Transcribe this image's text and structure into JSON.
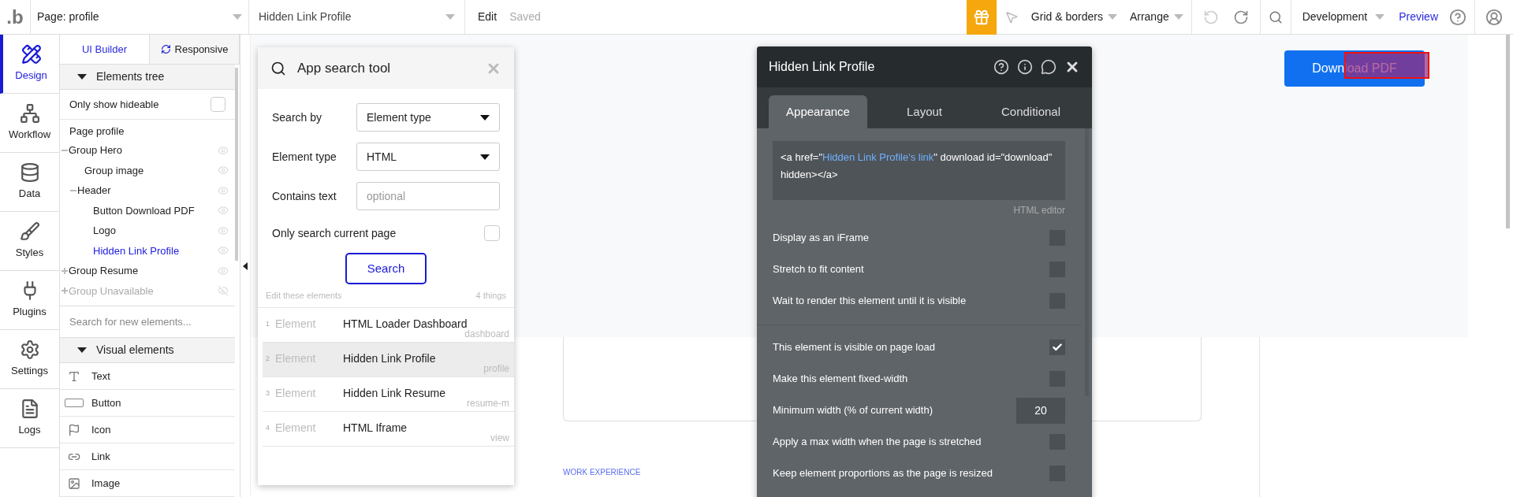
{
  "top_bar": {
    "logo": ".b",
    "page_dropdown": "Page: profile",
    "element_dropdown": "Hidden Link Profile",
    "edit_label": "Edit",
    "status": "Saved",
    "menus": [
      "Grid & borders",
      "Arrange"
    ],
    "environment": "Development",
    "preview": "Preview"
  },
  "left_nav": [
    {
      "label": "Design",
      "selected": true
    },
    {
      "label": "Workflow",
      "selected": false
    },
    {
      "label": "Data",
      "selected": false
    },
    {
      "label": "Styles",
      "selected": false
    },
    {
      "label": "Plugins",
      "selected": false
    },
    {
      "label": "Settings",
      "selected": false
    },
    {
      "label": "Logs",
      "selected": false
    }
  ],
  "panel_tabs": [
    {
      "label": "UI Builder",
      "selected": true
    },
    {
      "label": "Responsive",
      "selected": false
    }
  ],
  "elements_tree": {
    "title": "Elements tree",
    "filter": {
      "label": "Only show hideable",
      "checked": false
    },
    "page": "Page profile",
    "items": [
      {
        "label": "Group Hero",
        "kind": "group",
        "expanded": true,
        "selected": false,
        "hidden": false,
        "children": [
          {
            "label": "Group image",
            "kind": "element",
            "selected": false,
            "hidden": false
          },
          {
            "label": "Header",
            "kind": "group",
            "expanded": true,
            "selected": false,
            "hidden": false,
            "children": [
              {
                "label": "Button Download PDF",
                "kind": "element",
                "selected": false,
                "hidden": false
              },
              {
                "label": "Logo",
                "kind": "element",
                "selected": false,
                "hidden": false
              },
              {
                "label": "Hidden Link Profile",
                "kind": "element",
                "selected": true,
                "hidden": false
              }
            ]
          }
        ]
      },
      {
        "label": "Group Resume",
        "kind": "group",
        "expanded": false,
        "selected": false,
        "hidden": false
      },
      {
        "label": "Group Unavailable",
        "kind": "group",
        "expanded": false,
        "selected": false,
        "hidden": true
      }
    ]
  },
  "element_search": {
    "placeholder": "Search for new elements..."
  },
  "visual_elements": {
    "title": "Visual elements",
    "items": [
      "Text",
      "Button",
      "Icon",
      "Link",
      "Image"
    ]
  },
  "search_tool": {
    "title": "App search tool",
    "fields": [
      {
        "label": "Search by",
        "kind": "select",
        "value": "Element type"
      },
      {
        "label": "Element type",
        "kind": "select",
        "value": "HTML"
      },
      {
        "label": "Contains text",
        "kind": "text",
        "placeholder": "optional"
      }
    ],
    "option": {
      "label": "Only search current page",
      "checked": false
    },
    "button": "Search",
    "caption": "Edit these elements",
    "count": "4 things",
    "results": [
      {
        "index": "1",
        "type": "Element",
        "name": "HTML Loader Dashboard",
        "page": "dashboard",
        "selected": false
      },
      {
        "index": "2",
        "type": "Element",
        "name": "Hidden Link Profile",
        "page": "profile",
        "selected": true
      },
      {
        "index": "3",
        "type": "Element",
        "name": "Hidden Link Resume",
        "page": "resume-m",
        "selected": false
      },
      {
        "index": "4",
        "type": "Element",
        "name": "HTML Iframe",
        "page": "view",
        "selected": false
      }
    ]
  },
  "property_editor": {
    "title": "Hidden Link Profile",
    "tabs": [
      {
        "label": "Appearance",
        "selected": true
      },
      {
        "label": "Layout",
        "selected": false
      },
      {
        "label": "Conditional",
        "selected": false
      }
    ],
    "code": [
      {
        "kind": "plain",
        "text": "<a href=\""
      },
      {
        "kind": "dynamic",
        "text": "Hidden Link Profile's link"
      },
      {
        "kind": "plain",
        "text": "\" download id=\"download\" hidden></a>"
      }
    ],
    "code_caption": "HTML editor",
    "sections": [
      {
        "options": [
          {
            "kind": "checkbox",
            "label": "Display as an iFrame",
            "checked": false
          },
          {
            "kind": "checkbox",
            "label": "Stretch to fit content",
            "checked": false
          },
          {
            "kind": "checkbox",
            "label": "Wait to render this element until it is visible",
            "checked": false
          }
        ]
      },
      {
        "options": [
          {
            "kind": "checkbox",
            "label": "This element is visible on page load",
            "checked": true
          },
          {
            "kind": "checkbox",
            "label": "Make this element fixed-width",
            "checked": false
          },
          {
            "kind": "number",
            "label": "Minimum width (% of current width)",
            "value": "20"
          },
          {
            "kind": "checkbox",
            "label": "Apply a max width when the page is stretched",
            "checked": false
          },
          {
            "kind": "checkbox",
            "label": "Keep element proportions as the page is resized",
            "checked": false
          }
        ]
      }
    ]
  },
  "canvas": {
    "download_button": "Download PDF",
    "section_label": "WORK EXPERIENCE"
  }
}
